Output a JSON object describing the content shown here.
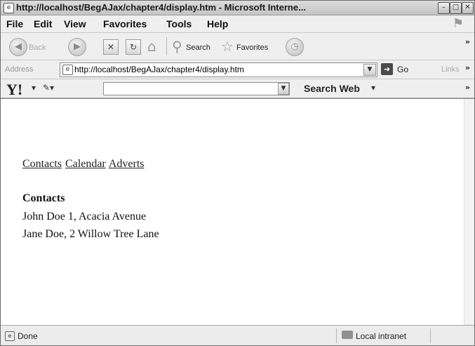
{
  "window": {
    "title": "http://localhost/BegAJax/chapter4/display.htm - Microsoft Interne...",
    "controls": {
      "minimize": "–",
      "maximize": "□",
      "close": "✕"
    }
  },
  "menu": {
    "items": [
      "File",
      "Edit",
      "View",
      "Favorites",
      "Tools",
      "Help"
    ],
    "overflow": "»"
  },
  "toolbar": {
    "back_label": "Back",
    "search_label": "Search",
    "favorites_label": "Favorites",
    "overflow": "»"
  },
  "address": {
    "label": "Address",
    "url": "http://localhost/BegAJax/chapter4/display.htm",
    "go_label": "Go",
    "links_label": "Links",
    "overflow": "»"
  },
  "yahoo": {
    "logo": "Y!",
    "search_value": "",
    "search_web_label": "Search Web",
    "overflow": "»"
  },
  "page": {
    "nav_links": [
      "Contacts",
      "Calendar",
      "Adverts"
    ],
    "heading": "Contacts",
    "contacts": [
      "John Doe 1, Acacia Avenue",
      "Jane Doe, 2 Willow Tree Lane"
    ]
  },
  "status": {
    "text": "Done",
    "zone": "Local intranet"
  },
  "icons": {
    "back": "back-arrow-icon",
    "forward": "forward-arrow-icon",
    "stop": "stop-icon",
    "refresh": "refresh-icon",
    "home": "home-icon",
    "search": "search-icon",
    "favorites": "favorites-star-icon",
    "history": "history-icon"
  }
}
